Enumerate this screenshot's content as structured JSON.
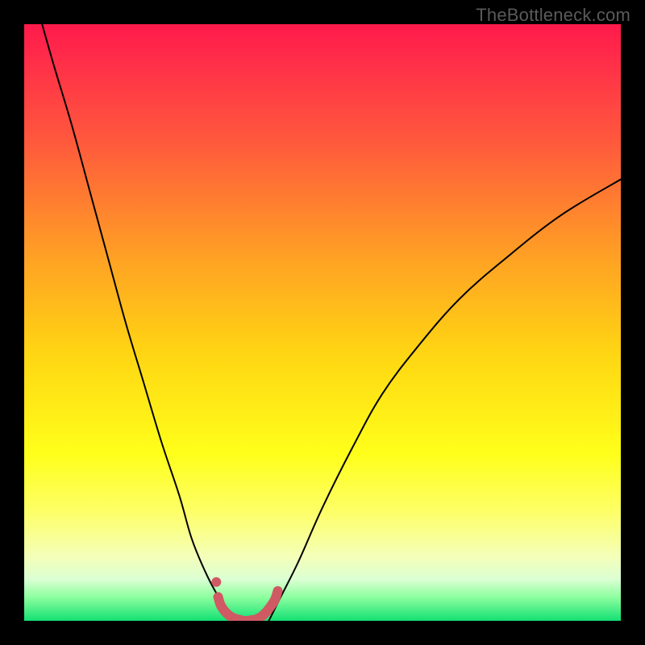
{
  "watermark": "TheBottleneck.com",
  "chart_data": {
    "type": "line",
    "title": "",
    "xlabel": "",
    "ylabel": "",
    "xlim": [
      0,
      100
    ],
    "ylim": [
      0,
      100
    ],
    "background_gradient": {
      "stops": [
        {
          "offset": 0.0,
          "color": "#ff1a4b"
        },
        {
          "offset": 0.05,
          "color": "#ff2a4a"
        },
        {
          "offset": 0.2,
          "color": "#ff5a3c"
        },
        {
          "offset": 0.4,
          "color": "#ffa423"
        },
        {
          "offset": 0.55,
          "color": "#ffd513"
        },
        {
          "offset": 0.72,
          "color": "#ffff1a"
        },
        {
          "offset": 0.82,
          "color": "#fdff6a"
        },
        {
          "offset": 0.89,
          "color": "#f5ffb6"
        },
        {
          "offset": 0.93,
          "color": "#dcffd3"
        },
        {
          "offset": 0.96,
          "color": "#8effa0"
        },
        {
          "offset": 1.0,
          "color": "#13e073"
        }
      ]
    },
    "series": [
      {
        "name": "curve-left",
        "color": "#000000",
        "width": 2,
        "x": [
          3,
          5,
          8,
          11,
          14,
          17,
          20,
          23,
          26,
          28,
          30,
          32,
          34,
          36
        ],
        "y": [
          100,
          93,
          83,
          72,
          61,
          50,
          40,
          30,
          21,
          14,
          9,
          5,
          2,
          0
        ]
      },
      {
        "name": "curve-right",
        "color": "#000000",
        "width": 2,
        "x": [
          41,
          43,
          46,
          50,
          55,
          60,
          66,
          73,
          81,
          90,
          100
        ],
        "y": [
          0,
          4,
          10,
          19,
          29,
          38,
          46,
          54,
          61,
          68,
          74
        ]
      },
      {
        "name": "highlight-band",
        "color": "#cf5a63",
        "width": 12,
        "x": [
          32.5,
          33,
          34,
          35,
          36,
          37,
          38,
          39,
          40,
          41,
          42,
          42.5
        ],
        "y": [
          4.0,
          2.5,
          1.2,
          0.5,
          0.2,
          0.0,
          0.1,
          0.3,
          0.9,
          2.0,
          3.5,
          5.0
        ]
      }
    ],
    "markers": [
      {
        "name": "dot-left",
        "x": 32.2,
        "y": 6.5,
        "r": 6,
        "color": "#cf5a63"
      }
    ]
  }
}
